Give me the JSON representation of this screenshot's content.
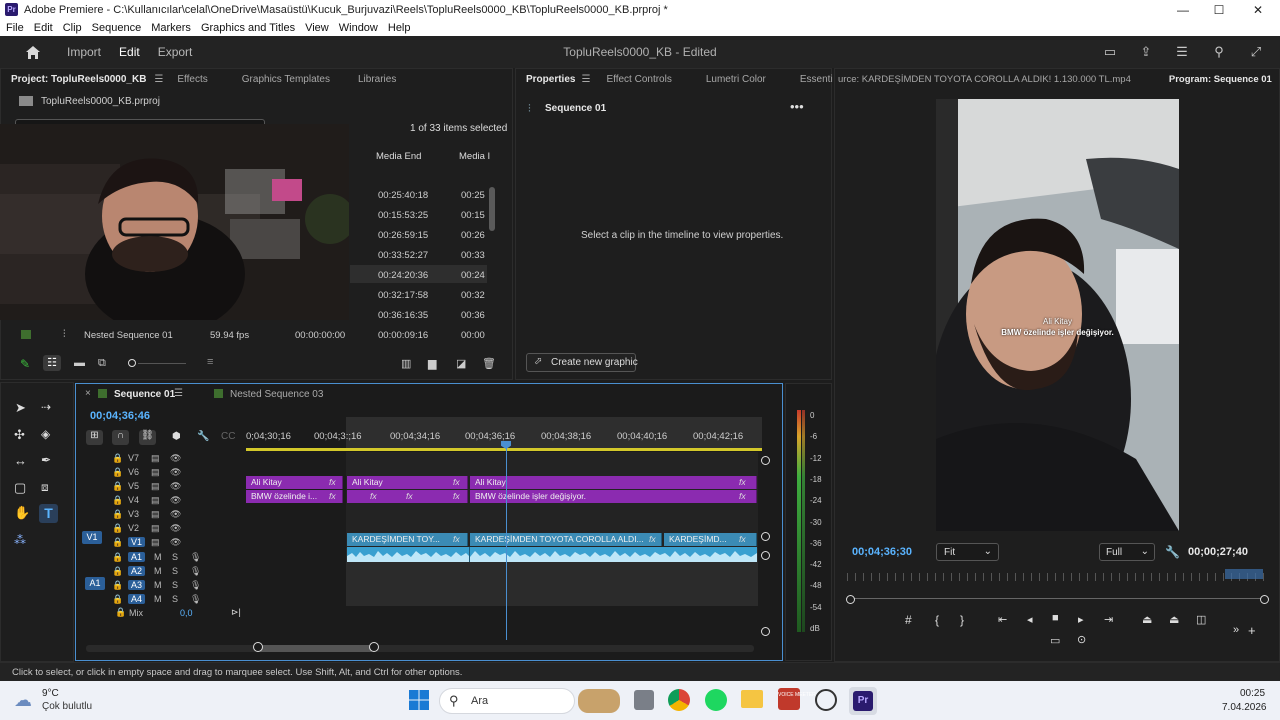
{
  "window": {
    "title": "Adobe Premiere - C:\\Kullanıcılar\\celal\\OneDrive\\Masaüstü\\Kucuk_Burjuvazi\\Reels\\TopluReels0000_KB\\TopluReels0000_KB.prproj *",
    "app_icon_label": "Pr",
    "minimize": "—",
    "maximize": "☐",
    "close": "✕"
  },
  "menu": [
    "File",
    "Edit",
    "Clip",
    "Sequence",
    "Markers",
    "Graphics and Titles",
    "View",
    "Window",
    "Help"
  ],
  "workspace": {
    "home_icon": "home-icon",
    "tabs": [
      "Import",
      "Edit",
      "Export"
    ],
    "active_tab": "Edit",
    "project_title": "TopluReels0000_KB - Edited"
  },
  "project_panel": {
    "tabs": [
      "Project: TopluReels0000_KB",
      "Effects",
      "Graphics Templates",
      "Libraries"
    ],
    "file": "TopluReels0000_KB.prproj",
    "selection_info": "1 of 33 items selected",
    "columns": [
      "Media End",
      "Media I"
    ],
    "rows": [
      {
        "media_end": "00:25:40:18",
        "media_in": "00:25"
      },
      {
        "media_end": "00:15:53:25",
        "media_in": "00:15"
      },
      {
        "media_end": "00:26:59:15",
        "media_in": "00:26"
      },
      {
        "media_end": "00:33:52:27",
        "media_in": "00:33"
      },
      {
        "media_end": "00:24:20:36",
        "media_in": "00:24"
      },
      {
        "media_end": "00:32:17:58",
        "media_in": "00:32"
      },
      {
        "media_end": "00:36:16:35",
        "media_in": "00:36"
      },
      {
        "media_end": "00:00:09:16",
        "media_in": "00:00"
      }
    ],
    "nested_row": {
      "name": "Nested Sequence 01",
      "fps": "59.94 fps",
      "start": "00:00:00:00"
    }
  },
  "properties_panel": {
    "tabs": [
      "Properties",
      "Effect Controls",
      "Lumetri Color",
      "Essenti"
    ],
    "sequence_name": "Sequence 01",
    "empty_message": "Select a clip in the timeline to view properties.",
    "create_button": "Create new graphic"
  },
  "program_monitor": {
    "source_tab": "urce: KARDEŞİMDEN TOYOTA COROLLA ALDIK! 1.130.000 TL.mp4",
    "program_tab": "Program: Sequence 01",
    "caption_name": "Ali Kitay",
    "caption_text": "BMW özelinde işler değişiyor.",
    "timecode": "00;04;36;30",
    "fit": "Fit",
    "quality": "Full",
    "duration": "00;00;27;40"
  },
  "timeline": {
    "tabs": [
      "Sequence 01",
      "Nested Sequence 03"
    ],
    "timecode": "00;04;36;46",
    "ruler": [
      "0;04;30;16",
      "00;04;3:;16",
      "00;04;34;16",
      "00;04;36;16",
      "00;04;38;16",
      "00;04;40;16",
      "00;04;42;16"
    ],
    "video_tracks": [
      "V7",
      "V6",
      "V5",
      "V4",
      "V3",
      "V2",
      "V1"
    ],
    "audio_tracks": [
      "A1",
      "A2",
      "A3",
      "A4"
    ],
    "mix_label": "Mix",
    "mix_value": "0,0",
    "v5_clips": [
      "Ali Kitay",
      "Ali Kitay",
      "Ali Kitay"
    ],
    "v4_clips": [
      "BMW özelinde i...",
      "BMW özelinde işler değişiyor."
    ],
    "v1_clips": [
      "KARDEŞİMDEN TOY...",
      "KARDEŞİMDEN TOYOTA COROLLA ALDI...",
      "KARDEŞİMD..."
    ],
    "fx_label": "fx",
    "src_v1": "V1",
    "src_a1": "A1"
  },
  "audio_meter": {
    "scale": [
      "0",
      "-6",
      "-12",
      "-18",
      "-24",
      "-30",
      "-36",
      "-42",
      "-48",
      "-54",
      "dB"
    ]
  },
  "status_bar": "Click to select, or click in empty space and drag to marquee select. Use Shift, Alt, and Ctrl for other options.",
  "taskbar": {
    "temperature": "9°C",
    "weather": "Çok bulutlu",
    "search": "Ara",
    "time": "00:25",
    "date": "7.04.2026",
    "voicemeeter_label": "VOICE MEETER"
  }
}
